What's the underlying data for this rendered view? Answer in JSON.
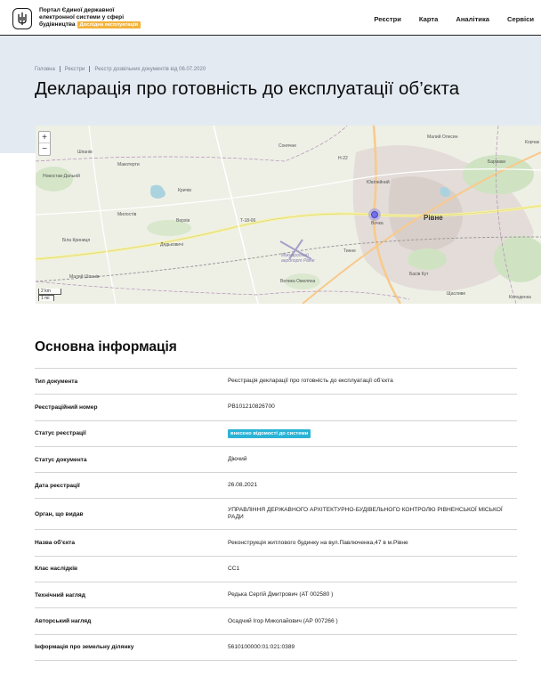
{
  "header": {
    "portal_line1": "Портал Єдиної державної",
    "portal_line2": "електронної системи у сфері",
    "portal_line3": "будівництва",
    "beta_label": "Дослідна експлуатація",
    "nav": [
      "Реєстри",
      "Карта",
      "Аналітика",
      "Сервіси"
    ]
  },
  "breadcrumb": [
    "Головна",
    "Реєстри",
    "Реєстр дозвільних документів від 06.07.2020"
  ],
  "page_title": "Декларація про готовність до експлуатації об’єкта",
  "map": {
    "zoom_in": "+",
    "zoom_out": "−",
    "scale_km": "2 km",
    "scale_mi": "1 mi",
    "labels": {
      "shpaniv": "Шпанів",
      "city": "Рівне",
      "novostav": "Новостав-Дальній",
      "makotery": "Макотерти",
      "krechiv": "Кричів",
      "bila_krynytsia": "Біла Криниця",
      "verkhiv": "Верхів",
      "miliostia": "Милостів",
      "basiv_kut": "Басів Кут",
      "tynne": "Тинне",
      "velyka_omeliana": "Велика Омеляна",
      "airport": "Міжнародний аеропорт Рівне",
      "road_h22": "H-22",
      "road_t1806": "T-18-06",
      "yuvileinyi": "Ювілейний",
      "solnechne": "Сонячне",
      "malyi_olesyn": "Малий Олесин",
      "korchak": "Корчак",
      "dydkovychi": "Дядьковичі",
      "mali_shchasnyky": "Малий Шпанів",
      "barmaky": "Бармаки",
      "kolodenka": "Колоденка",
      "shchasnyky": "Щасливе",
      "vochka": "Вочка"
    }
  },
  "section_title": "Основна інформація",
  "info": [
    {
      "key": "Тип документа",
      "value": "Реєстрація декларації про готовність до експлуатації об’єкта"
    },
    {
      "key": "Реєстраційний номер",
      "value": "РВ101210826700"
    },
    {
      "key": "Статус реєстрації",
      "value": "внесено відомості до системи",
      "badge": true
    },
    {
      "key": "Статус документа",
      "value": "Діючий"
    },
    {
      "key": "Дата реєстрації",
      "value": "26.08.2021"
    },
    {
      "key": "Орган, що видав",
      "value": "УПРАВЛІННЯ ДЕРЖАВНОГО АРХІТЕКТУРНО-БУДІВЕЛЬНОГО КОНТРОЛЮ РІВНЕНСЬКОЇ МІСЬКОЇ РАДИ"
    },
    {
      "key": "Назва об’єкта",
      "value": "Реконструкція житлового будинку на вул.Павлюченка,47 в м.Рівне"
    },
    {
      "key": "Клас наслідків",
      "value": "СС1"
    },
    {
      "key": "Технічний нагляд",
      "value": "Редька Сергій Дмитрович (АТ 002580 )"
    },
    {
      "key": "Авторський нагляд",
      "value": "Осадчий Ігор Миколайович (АР 007266 )"
    },
    {
      "key": "Інформація про земельну ділянку",
      "value": "5610100000:01:021:0389"
    }
  ]
}
